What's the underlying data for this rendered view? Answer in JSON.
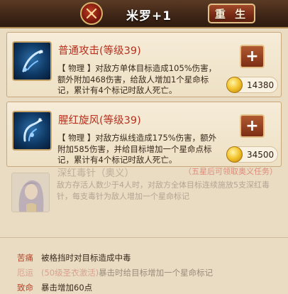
{
  "header": {
    "character_name": "米罗+1",
    "reborn_label": "重 生"
  },
  "skills": [
    {
      "title": "普通攻击(等级39)",
      "description": "【 物理 】对敌方单体目标造成105%伤害，额外附加468伤害，给敌人增加1个星命标记，累计有4个标记时敌人死亡。",
      "upgrade_label": "+",
      "cost": "14380",
      "icon": "scorpion-claw-icon"
    },
    {
      "title": "腥红旋风(等级39)",
      "description": "【 物理 】对敌方纵线造成175%伤害，额外附加585伤害，并给目标增加一个星命点标记，累计有4个标记时敌人死亡。",
      "upgrade_label": "+",
      "cost": "34500",
      "icon": "scarlet-whirlwind-icon"
    }
  ],
  "locked_skill": {
    "title": "深红毒针（奥义）",
    "unlock_tip": "（五星后可领取奥义任务）",
    "description": "敌方存活人数少于4人时，对敌方全体目标连续施放5支深红毒针，每支毒针为敌人增加一个星命标记"
  },
  "traits": [
    {
      "name": "苦痛",
      "condition": "",
      "description": "被格挡时对目标造成中毒"
    },
    {
      "name": "厄运",
      "condition": "(50级圣衣激活)",
      "description": "暴击时给目标增加一个星命标记"
    },
    {
      "name": "致命",
      "condition": "",
      "description": "暴击增加60点"
    }
  ],
  "colors": {
    "header_bg": "#3e2516",
    "panel_bg": "#e9dcc3",
    "skill_title": "#b8301e",
    "button_red": "#7c2e14",
    "gold_border": "#e2c088"
  }
}
